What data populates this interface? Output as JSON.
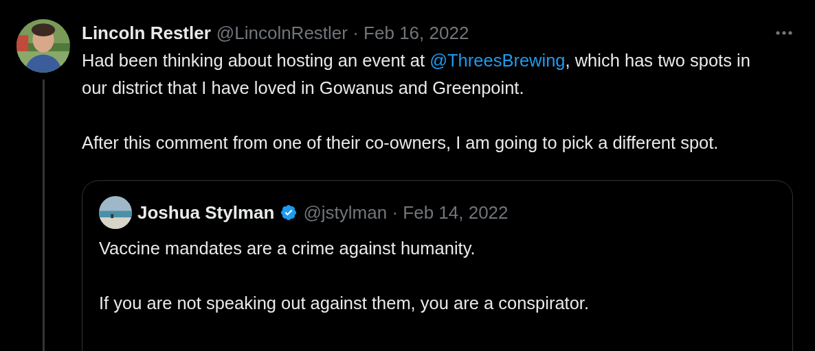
{
  "tweet": {
    "author": "Lincoln Restler",
    "handle": "@LincolnRestler",
    "separator": "·",
    "date": "Feb 16, 2022",
    "paragraphs": [
      {
        "kind": "mention",
        "before": "Had been thinking about hosting an event at ",
        "mention": "@ThreesBrewing",
        "after": ", which has two spots in our district that I have loved in Gowanus and Greenpoint."
      },
      {
        "kind": "plain",
        "text": "After this comment from one of their co-owners, I am going to pick a different spot."
      }
    ],
    "quote": {
      "author": "Joshua Stylman",
      "verified": true,
      "handle": "@jstylman",
      "separator": "·",
      "date": "Feb 14, 2022",
      "paragraphs": [
        "Vaccine mandates are a crime against humanity.",
        "If you are not speaking out against them, you are a conspirator."
      ]
    }
  }
}
